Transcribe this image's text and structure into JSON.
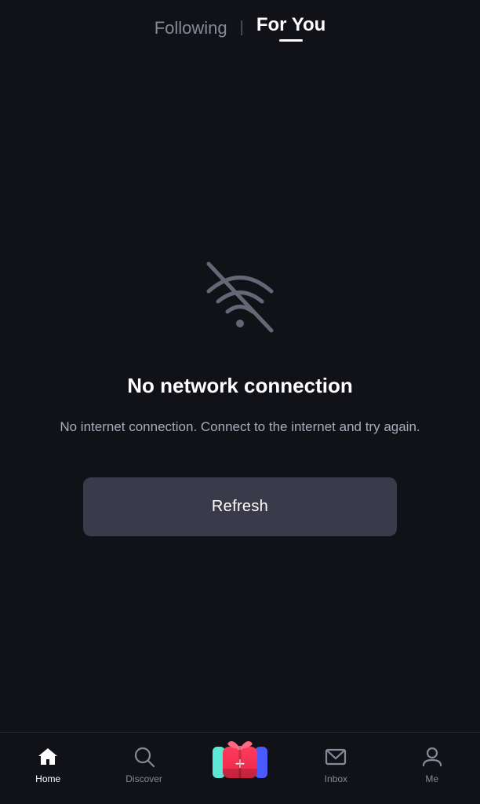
{
  "topNav": {
    "following_label": "Following",
    "divider": "|",
    "for_you_label": "For You"
  },
  "error": {
    "title": "No network connection",
    "subtitle": "No internet connection. Connect to the internet and try again."
  },
  "refresh_button": "Refresh",
  "bottomNav": {
    "items": [
      {
        "id": "home",
        "label": "Home",
        "active": true
      },
      {
        "id": "discover",
        "label": "Discover",
        "active": false
      },
      {
        "id": "add",
        "label": "",
        "active": false
      },
      {
        "id": "inbox",
        "label": "Inbox",
        "active": false
      },
      {
        "id": "me",
        "label": "Me",
        "active": false
      }
    ]
  }
}
